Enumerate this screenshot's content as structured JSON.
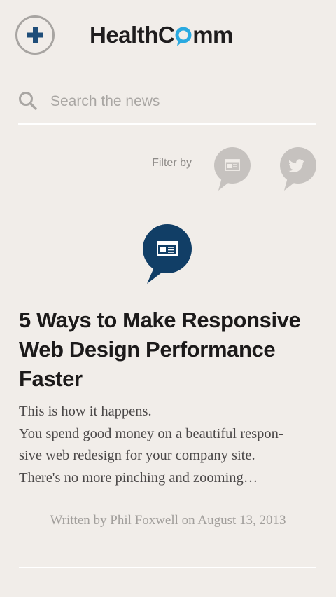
{
  "header": {
    "logo_text_before": "HealthC",
    "logo_text_after": "mm",
    "accent_color": "#1f4e79",
    "logo_accent_color": "#29a9e0"
  },
  "search": {
    "placeholder": "Search the news",
    "value": ""
  },
  "filter": {
    "label": "Filter by",
    "options": [
      {
        "icon": "newspaper-icon",
        "kind": "news"
      },
      {
        "icon": "twitter-icon",
        "kind": "twitter"
      }
    ]
  },
  "article": {
    "type_icon": "newspaper-icon",
    "title": "5 Ways to Make Responsive Web Design Performance Faster",
    "excerpt_lines": [
      "This is how it happens.",
      "You spend good money on a beautiful respon-",
      "sive web redesign for your company site.",
      "There's no more pinching and zooming…"
    ],
    "byline": "Written by Phil Foxwell on August 13, 2013"
  }
}
